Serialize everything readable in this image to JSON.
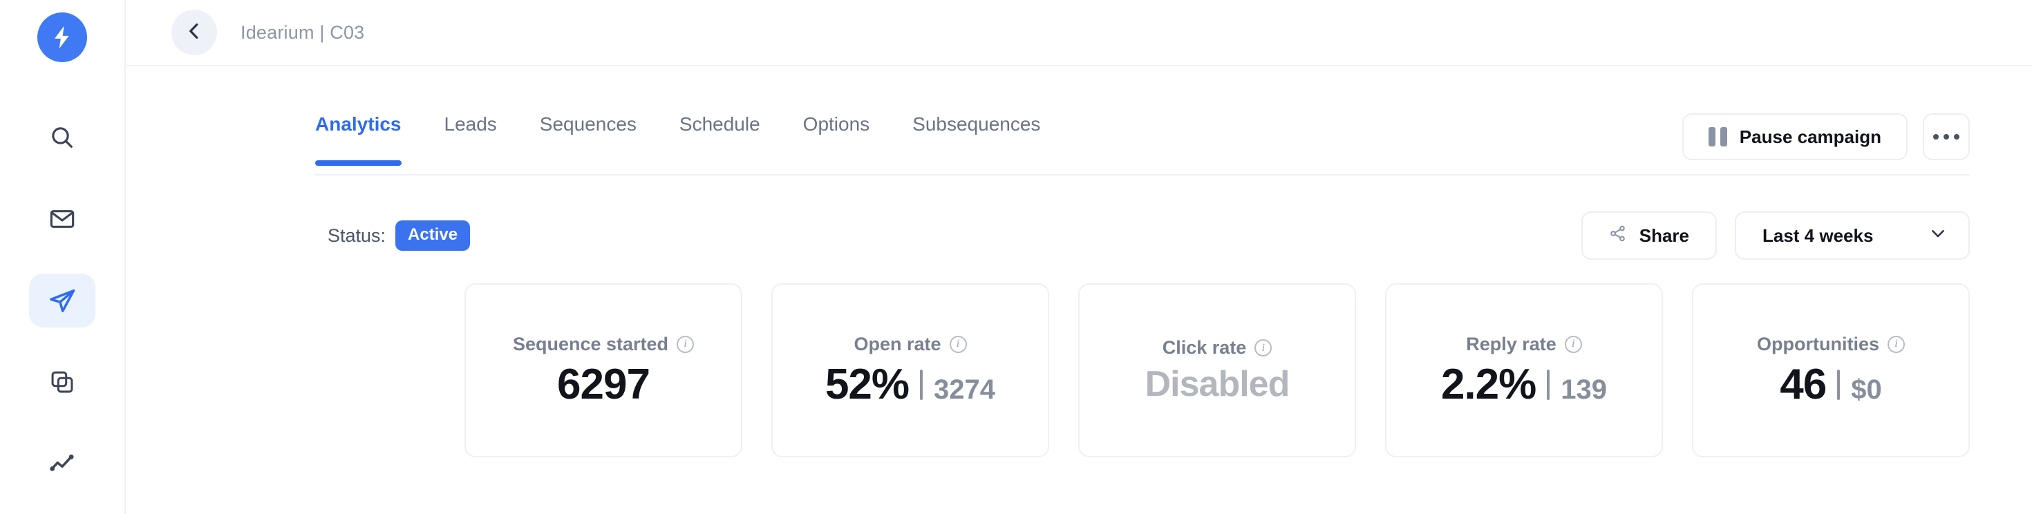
{
  "sidebar": {
    "logo_icon": "lightning-bolt-logo",
    "brand_color": "#4079f4",
    "items": [
      {
        "name": "search",
        "icon": "search-icon",
        "active": false
      },
      {
        "name": "inbox",
        "icon": "envelope-icon",
        "active": false
      },
      {
        "name": "campaigns",
        "icon": "paper-plane-icon",
        "active": true
      },
      {
        "name": "copies",
        "icon": "stacked-squares-icon",
        "active": false
      },
      {
        "name": "analytics",
        "icon": "trend-line-icon",
        "active": false
      }
    ]
  },
  "header": {
    "back_icon": "chevron-left-icon",
    "breadcrumb": "Idearium | C03"
  },
  "tabs": [
    {
      "label": "Analytics",
      "active": true
    },
    {
      "label": "Leads",
      "active": false
    },
    {
      "label": "Sequences",
      "active": false
    },
    {
      "label": "Schedule",
      "active": false
    },
    {
      "label": "Options",
      "active": false
    },
    {
      "label": "Subsequences",
      "active": false
    }
  ],
  "tab_actions": {
    "pause_label": "Pause campaign",
    "pause_icon": "pause-icon",
    "more_icon": "ellipsis-icon"
  },
  "status": {
    "label": "Status:",
    "value": "Active",
    "badge_color": "#3b72f0"
  },
  "filters": {
    "share_label": "Share",
    "share_icon": "share-nodes-icon",
    "range_label": "Last 4 weeks",
    "range_caret_icon": "chevron-down-icon"
  },
  "metrics": [
    {
      "label": "Sequence started",
      "info_icon": "info-icon",
      "primary": "6297",
      "secondary": "",
      "has_separator": false,
      "disabled": false
    },
    {
      "label": "Open rate",
      "info_icon": "info-icon",
      "primary": "52%",
      "secondary": "3274",
      "has_separator": true,
      "disabled": false
    },
    {
      "label": "Click rate",
      "info_icon": "info-icon",
      "primary": "Disabled",
      "secondary": "",
      "has_separator": false,
      "disabled": true
    },
    {
      "label": "Reply rate",
      "info_icon": "info-icon",
      "primary": "2.2%",
      "secondary": "139",
      "has_separator": true,
      "disabled": false
    },
    {
      "label": "Opportunities",
      "info_icon": "info-icon",
      "primary": "46",
      "secondary": "$0",
      "has_separator": true,
      "disabled": false
    }
  ]
}
